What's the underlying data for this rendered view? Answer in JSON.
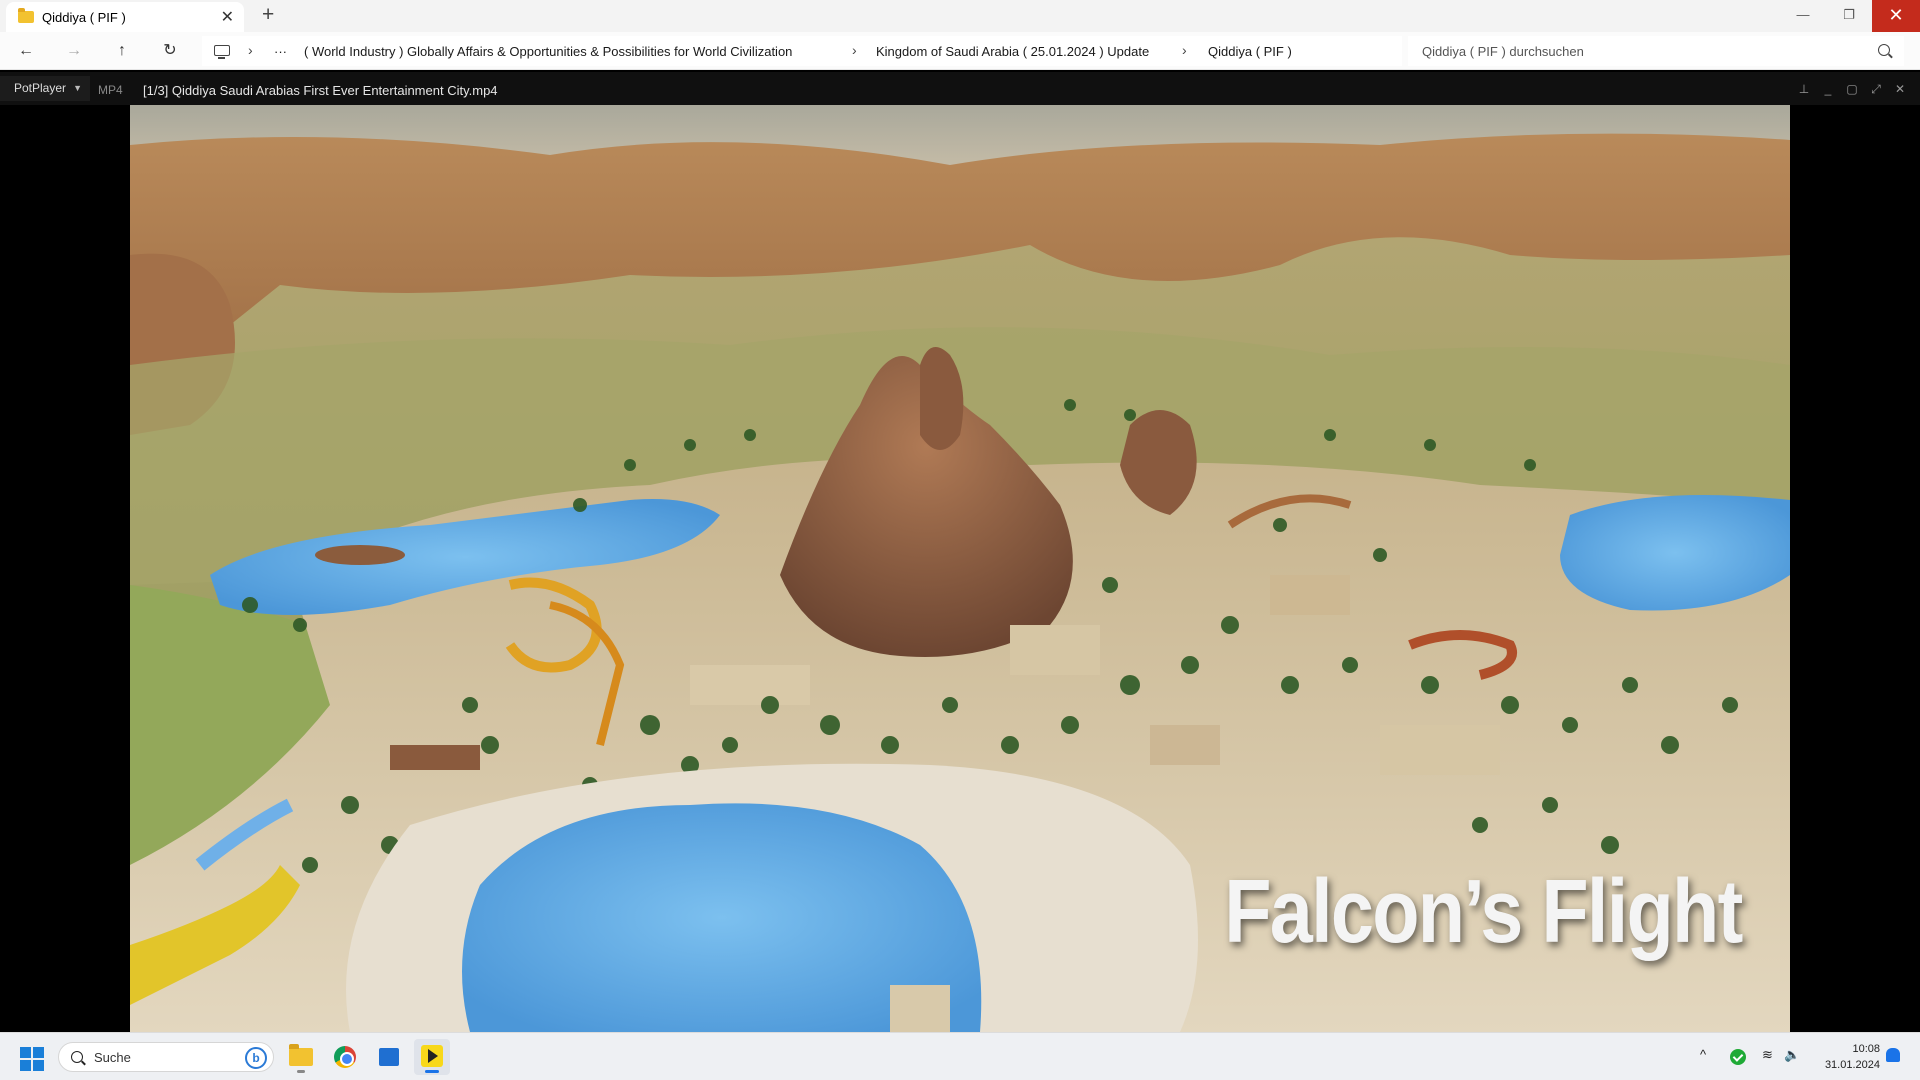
{
  "explorer": {
    "tab_title": "Qiddiya ( PIF )",
    "tab_close": "✕",
    "new_tab": "+",
    "window_controls": {
      "minimize": "—",
      "maximize": "❐",
      "close": "✕"
    },
    "nav": {
      "back": "←",
      "forward": "→",
      "up": "↑",
      "refresh": "↻"
    },
    "breadcrumb": [
      "···",
      "( World Industry ) Globally Affairs & Opportunities & Possibilities for World Civilization",
      "Kingdom of Saudi Arabia ( 25.01.2024 ) Update",
      "Qiddiya ( PIF )"
    ],
    "search_placeholder": "Qiddiya ( PIF ) durchsuchen"
  },
  "player": {
    "menu_label": "PotPlayer",
    "format": "MP4",
    "file_title": "[1/3] Qiddiya  Saudi Arabias First Ever Entertainment City.mp4",
    "controls": {
      "pin": "⊥",
      "minimize": "_",
      "maximize": "▢",
      "fullscreen": "⤢",
      "close": "✕"
    },
    "caption": "Falcon’s Flight"
  },
  "taskbar": {
    "search_label": "Suche",
    "bing_label": "b",
    "tray": {
      "chevron": "^",
      "wifi": "≋",
      "volume": "🔈"
    },
    "time": "10:08",
    "date": "31.01.2024"
  },
  "colors": {
    "close_red": "#c42b1c",
    "player_bar": "#101010",
    "taskbar": "#eef0f3",
    "accent": "#1a73e8"
  }
}
